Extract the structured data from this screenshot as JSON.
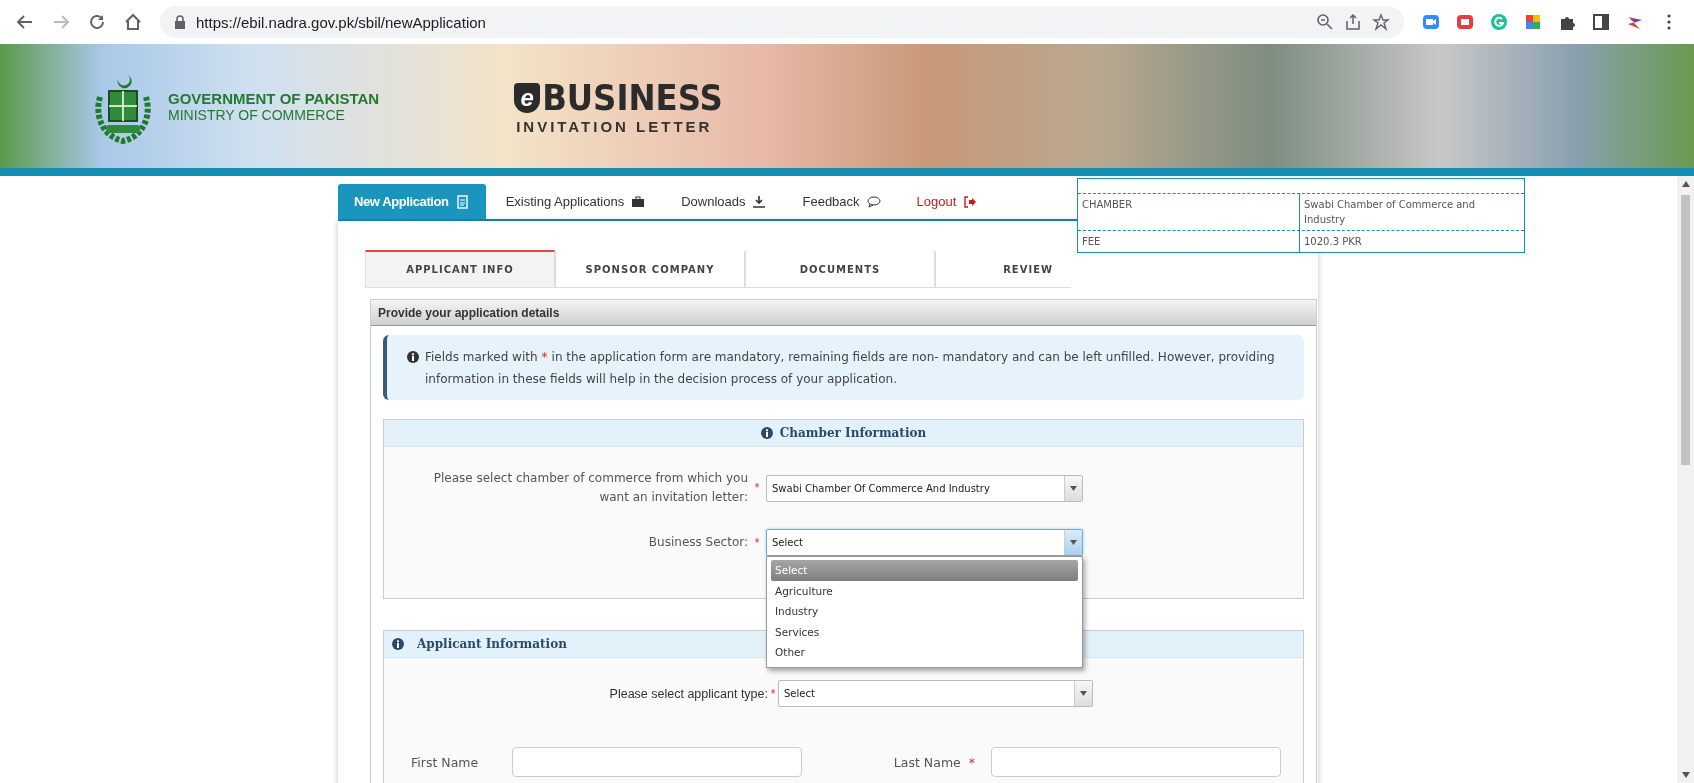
{
  "browser": {
    "url": "https://ebil.nadra.gov.pk/sbil/newApplication"
  },
  "header": {
    "org_line1": "GOVERNMENT OF PAKISTAN",
    "org_line2": "MINISTRY OF COMMERCE",
    "logo_mark": "e",
    "title": "BUSINESS",
    "subtitle": "INVITATION LETTER"
  },
  "nav_tabs": [
    {
      "label": "New Application",
      "selected": true,
      "kind": "page"
    },
    {
      "label": "Existing Applications",
      "selected": false,
      "kind": "page"
    },
    {
      "label": "Downloads",
      "selected": false,
      "kind": "page"
    },
    {
      "label": "Feedback",
      "selected": false,
      "kind": "page"
    },
    {
      "label": "Logout",
      "selected": false,
      "kind": "logout"
    }
  ],
  "summary": {
    "rows": [
      {
        "label": "CHAMBER",
        "value": "Swabi Chamber of Commerce and Industry"
      },
      {
        "label": "FEE",
        "value": "1020.3 PKR"
      }
    ]
  },
  "steps": [
    {
      "label": "APPLICANT INFO",
      "selected": true
    },
    {
      "label": "SPONSOR COMPANY",
      "selected": false
    },
    {
      "label": "DOCUMENTS",
      "selected": false
    },
    {
      "label": "REVIEW",
      "selected": false
    }
  ],
  "panel_title": "Provide your application details",
  "notice": {
    "text_before": "Fields marked with",
    "required_mark": "*",
    "text_after": "in the application form are mandatory, remaining fields are non- mandatory and can be left unfilled. However, providing information in these fields will help in the decision process of your application."
  },
  "chamber_section": {
    "title": "Chamber Information",
    "fields": [
      {
        "label": "Please select chamber of commerce from which you want an invitation letter:",
        "required_mark": "*",
        "value": "Swabi Chamber Of Commerce And Industry",
        "focused": false
      },
      {
        "label": "Business Sector:",
        "required_mark": "*",
        "value": "Select",
        "focused": true,
        "options": [
          {
            "label": "Select",
            "selected": true
          },
          {
            "label": "Agriculture",
            "selected": false
          },
          {
            "label": "Industry",
            "selected": false
          },
          {
            "label": "Services",
            "selected": false
          },
          {
            "label": "Other",
            "selected": false
          }
        ]
      }
    ]
  },
  "applicant_section": {
    "title": "Applicant Information",
    "type_field": {
      "label": "Please select applicant type:",
      "required_mark": "*",
      "value": "Select"
    },
    "name_fields": [
      {
        "label": "First Name"
      },
      {
        "label": "Last Name",
        "required_mark": "*"
      }
    ]
  }
}
